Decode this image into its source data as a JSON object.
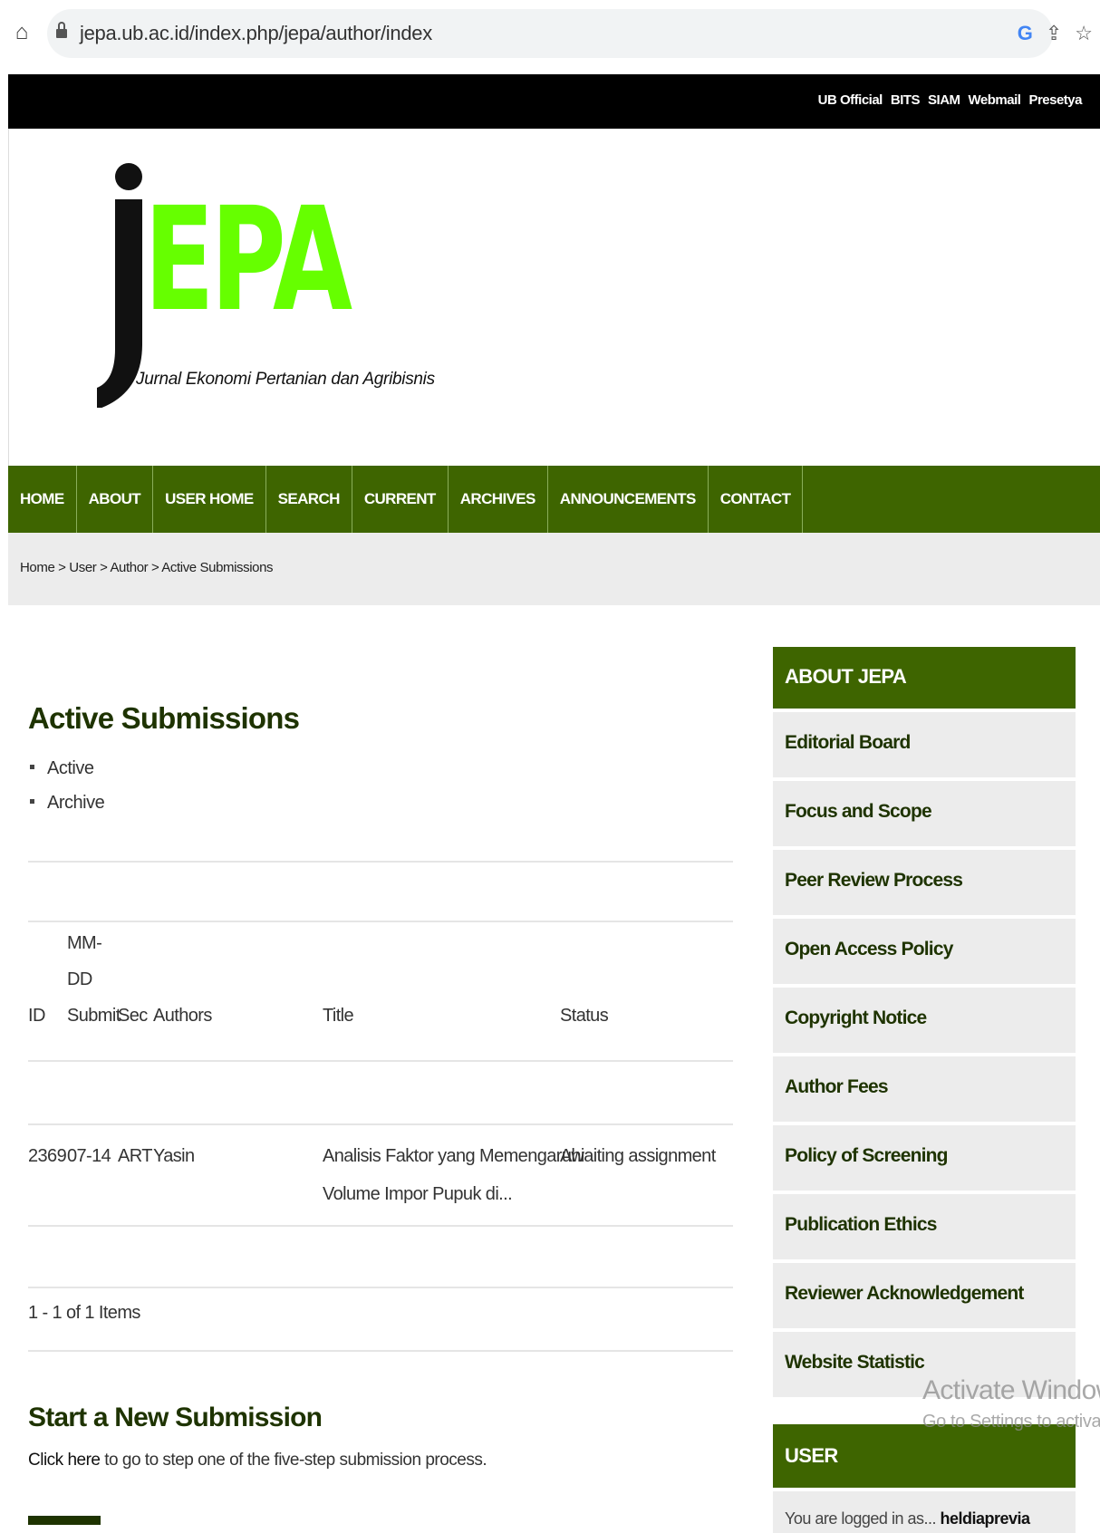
{
  "browser": {
    "url": "jepa.ub.ac.id/index.php/jepa/author/index",
    "icons": [
      "home-icon",
      "lock-icon",
      "google-icon",
      "share-icon",
      "star-icon"
    ]
  },
  "topbar": {
    "links": [
      "UB Official",
      "BITS",
      "SIAM",
      "Webmail",
      "Presetya"
    ]
  },
  "logo": {
    "j": "j",
    "epa": "EPA",
    "tagline": "Jurnal Ekonomi Pertanian dan Agribisnis"
  },
  "nav": {
    "items": [
      "HOME",
      "ABOUT",
      "USER HOME",
      "SEARCH",
      "CURRENT",
      "ARCHIVES",
      "ANNOUNCEMENTS",
      "CONTACT"
    ]
  },
  "breadcrumb": "Home > User > Author > Active Submissions",
  "main": {
    "title": "Active Submissions",
    "filters": [
      "Active",
      "Archive"
    ],
    "table": {
      "headers": {
        "id": "ID",
        "submit_line1": "MM-",
        "submit_line2": "DD",
        "submit_line3": "Submit",
        "sec": "Sec",
        "authors": "Authors",
        "title": "Title",
        "status": "Status"
      },
      "rows": [
        {
          "id": "2369",
          "submit": "07-14",
          "sec": "ART",
          "authors": "Yasin",
          "title_line1": "Analisis Faktor yang Memengaruhi",
          "title_line2": "Volume Impor Pupuk di...",
          "status": "Awaiting assignment"
        }
      ],
      "pagination": "1 - 1 of 1 Items"
    },
    "new_submission": {
      "title": "Start a New Submission",
      "link_text": "Click here",
      "text": " to go to step one of the five-step submission process."
    }
  },
  "sidebar": {
    "about_title": "ABOUT JEPA",
    "about_items": [
      "Editorial Board",
      "Focus and Scope",
      "Peer Review Process",
      "Open Access Policy",
      "Copyright Notice",
      "Author Fees",
      "Policy of Screening",
      "Publication Ethics",
      "Reviewer Acknowledgement",
      "Website Statistic"
    ],
    "user_title": "USER",
    "user_text": "You are logged in as...",
    "user_name": "heldiaprevia"
  },
  "watermark": {
    "line1": "Activate Windows",
    "line2": "Go to Settings to activate Windows."
  },
  "colors": {
    "nav_green": "#3e6500",
    "logo_green": "#66ff00",
    "heading_green": "#1e3300"
  }
}
